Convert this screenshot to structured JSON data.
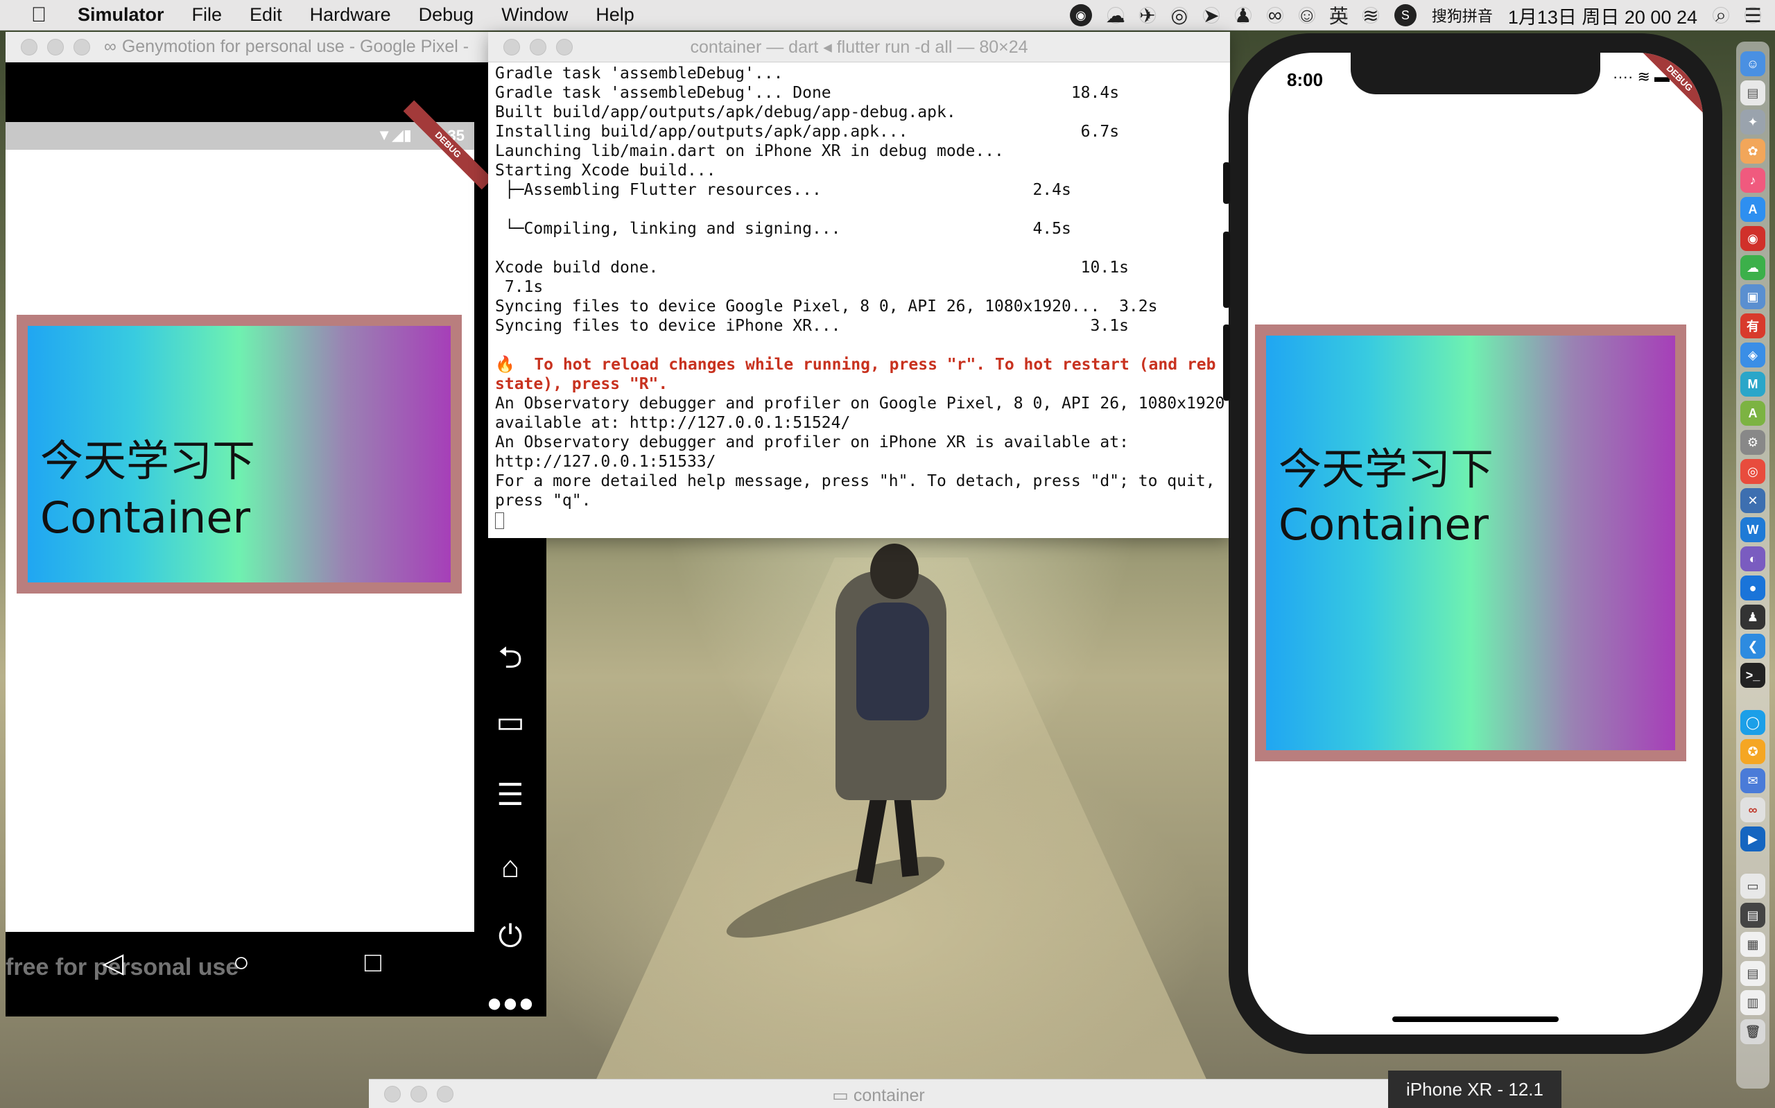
{
  "menubar": {
    "app_name": "Simulator",
    "menus": [
      "File",
      "Edit",
      "Hardware",
      "Debug",
      "Window",
      "Help"
    ],
    "ime_label": "搜狗拼音",
    "ime_mode": "英",
    "clock": "1月13日 周日  20 00 24"
  },
  "genymotion": {
    "title": "Genymotion for personal use - Google Pixel -",
    "status_time": "3:35",
    "debug_ribbon": "DEBUG",
    "container_line1": "今天学习下",
    "container_line2": "Container",
    "watermark": "free for personal use"
  },
  "terminal": {
    "title": "container — dart ◂ flutter run -d all — 80×24",
    "lines": [
      {
        "text": "Gradle task 'assembleDebug'...",
        "hot": false
      },
      {
        "text": "Gradle task 'assembleDebug'... Done                         18.4s",
        "hot": false
      },
      {
        "text": "Built build/app/outputs/apk/debug/app-debug.apk.",
        "hot": false
      },
      {
        "text": "Installing build/app/outputs/apk/app.apk...                  6.7s",
        "hot": false
      },
      {
        "text": "Launching lib/main.dart on iPhone XR in debug mode...",
        "hot": false
      },
      {
        "text": "Starting Xcode build...",
        "hot": false
      },
      {
        "text": " ├─Assembling Flutter resources...                      2.4s",
        "hot": false
      },
      {
        "text": "",
        "hot": false
      },
      {
        "text": " └─Compiling, linking and signing...                    4.5s",
        "hot": false
      },
      {
        "text": "",
        "hot": false
      },
      {
        "text": "Xcode build done.                                            10.1s",
        "hot": false
      },
      {
        "text": " 7.1s",
        "hot": false
      },
      {
        "text": "Syncing files to device Google Pixel, 8 0, API 26, 1080x1920...  3.2s",
        "hot": false
      },
      {
        "text": "Syncing files to device iPhone XR...                          3.1s",
        "hot": false
      },
      {
        "text": "",
        "hot": false
      },
      {
        "text": "🔥  To hot reload changes while running, press \"r\". To hot restart (and reb",
        "hot": true
      },
      {
        "text": "state), press \"R\".",
        "hot": true
      },
      {
        "text": "An Observatory debugger and profiler on Google Pixel, 8 0, API 26, 1080x1920",
        "hot": false
      },
      {
        "text": "available at: http://127.0.0.1:51524/",
        "hot": false
      },
      {
        "text": "An Observatory debugger and profiler on iPhone XR is available at:",
        "hot": false
      },
      {
        "text": "http://127.0.0.1:51533/",
        "hot": false
      },
      {
        "text": "For a more detailed help message, press \"h\". To detach, press \"d\"; to quit,",
        "hot": false
      },
      {
        "text": "press \"q\".",
        "hot": false
      }
    ]
  },
  "iphone": {
    "status_time": "8:00",
    "debug_ribbon": "DEBUG",
    "container_line1": "今天学习下",
    "container_line2": "Container",
    "device_label": "iPhone XR - 12.1"
  },
  "finder": {
    "title": "container"
  },
  "colors": {
    "container_border": "#b97e7e",
    "gradient_start": "#20a6f2",
    "gradient_mid": "#6ff1b0",
    "gradient_end": "#a63fb8",
    "hot_reload_text": "#c8321f"
  }
}
